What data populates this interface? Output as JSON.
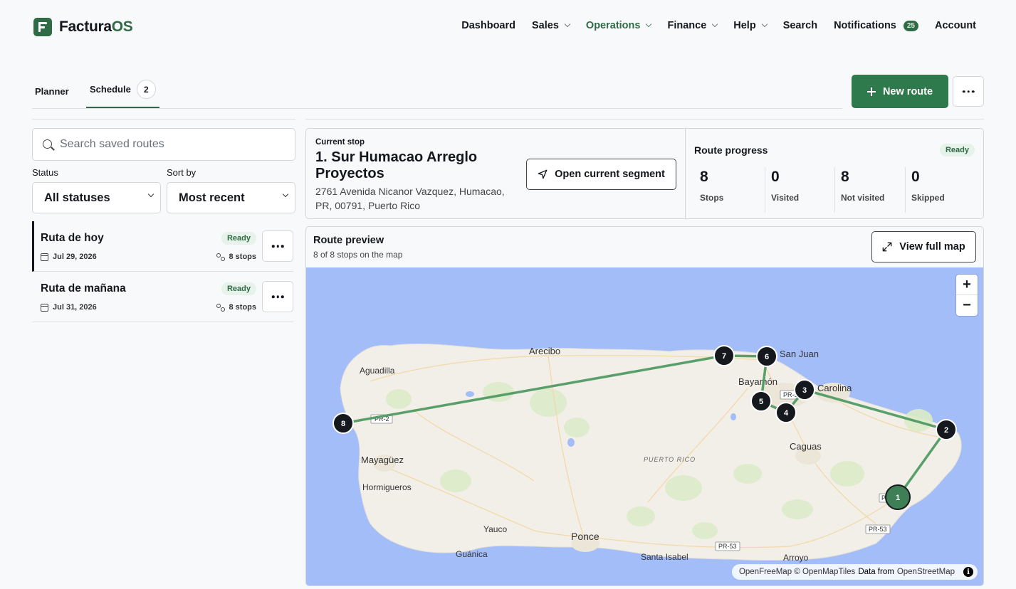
{
  "app": {
    "logo_prefix": "Factura",
    "logo_suffix": "OS"
  },
  "nav": {
    "dashboard": "Dashboard",
    "sales": "Sales",
    "operations": "Operations",
    "finance": "Finance",
    "help": "Help",
    "search": "Search",
    "notifications": "Notifications",
    "notifications_count": "25",
    "account": "Account"
  },
  "tabs": {
    "planner": "Planner",
    "schedule": "Schedule",
    "schedule_count": "2"
  },
  "toolbar": {
    "new_route": "New route"
  },
  "filters": {
    "search_placeholder": "Search saved routes",
    "status_label": "Status",
    "status_value": "All statuses",
    "sort_label": "Sort by",
    "sort_value": "Most recent"
  },
  "routes": [
    {
      "name": "Ruta de hoy",
      "status": "Ready",
      "date": "Jul 29, 2026",
      "stops": "8 stops"
    },
    {
      "name": "Ruta de mañana",
      "status": "Ready",
      "date": "Jul 31, 2026",
      "stops": "8 stops"
    }
  ],
  "current_stop": {
    "label": "Current stop",
    "title": "1. Sur Humacao Arreglo Proyectos",
    "address": "2761 Avenida Nicanor Vazquez, Humacao, PR, 00791, Puerto Rico",
    "open_segment": "Open current segment"
  },
  "progress": {
    "title": "Route progress",
    "status": "Ready",
    "stats": [
      {
        "value": "8",
        "label": "Stops"
      },
      {
        "value": "0",
        "label": "Visited"
      },
      {
        "value": "8",
        "label": "Not visited"
      },
      {
        "value": "0",
        "label": "Skipped"
      }
    ]
  },
  "preview": {
    "title": "Route preview",
    "subtitle": "8 of 8 stops on the map",
    "view_full_map": "View full map",
    "zoom_in": "+",
    "zoom_out": "−",
    "attribution_a": "OpenFreeMap © OpenMapTiles",
    "attribution_b": "Data from",
    "attribution_c": "OpenStreetMap",
    "info": "i"
  },
  "map": {
    "places": {
      "arecibo": "Arecibo",
      "aguadilla": "Aguadilla",
      "san_juan": "San Juan",
      "bayamon": "Bayamón",
      "carolina": "Carolina",
      "caguas": "Caguas",
      "mayaguez": "Mayagüez",
      "hormigueros": "Hormigueros",
      "yauco": "Yauco",
      "ponce": "Ponce",
      "guanica": "Guánica",
      "santa_isabel": "Santa Isabel",
      "arroyo": "Arroyo",
      "puerto_rico": "PUERTO RICO"
    },
    "shields": {
      "pr2": "PR-2",
      "pr52a": "PR-5",
      "pr53a": "PR-53",
      "pr53b": "PR-53",
      "pr_h": "PR"
    },
    "stops": [
      "1",
      "2",
      "3",
      "4",
      "5",
      "6",
      "7",
      "8"
    ],
    "colors": {
      "water": "#a3bdf8",
      "land": "#f2efe9",
      "route": "#4f9a63",
      "stop": "#15181d",
      "current_stop": "#3f7f55"
    }
  }
}
